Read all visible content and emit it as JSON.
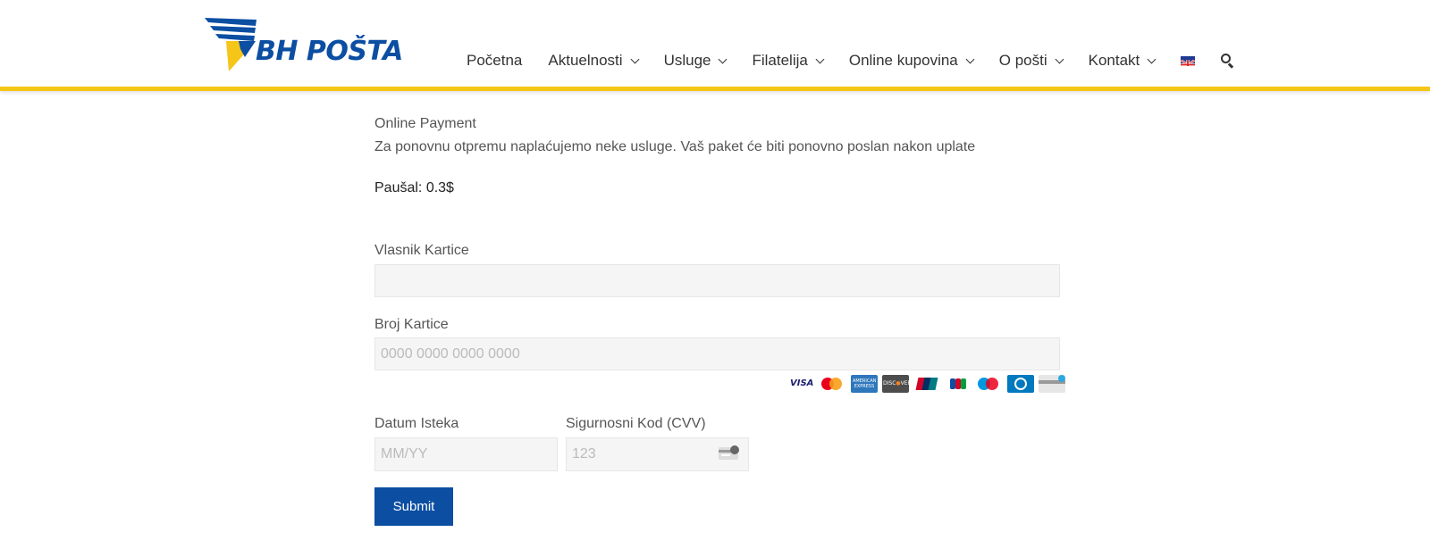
{
  "brand": {
    "logo_text": "BH POŠTA",
    "primary_color": "#0b4ea2",
    "accent_color": "#f5c518"
  },
  "nav": {
    "items": [
      {
        "label": "Početna",
        "has_dropdown": false
      },
      {
        "label": "Aktuelnosti",
        "has_dropdown": true
      },
      {
        "label": "Usluge",
        "has_dropdown": true
      },
      {
        "label": "Filatelija",
        "has_dropdown": true
      },
      {
        "label": "Online kupovina",
        "has_dropdown": true
      },
      {
        "label": "O pošti",
        "has_dropdown": true
      },
      {
        "label": "Kontakt",
        "has_dropdown": true
      }
    ],
    "language_icon": "uk-flag-icon",
    "search_icon": "search-icon"
  },
  "page": {
    "title": "Online Payment",
    "description": "Za ponovnu otpremu naplaćujemo neke usluge. Vaš paket će biti ponovno poslan nakon uplate",
    "fee": "Paušal: 0.3$"
  },
  "form": {
    "cardholder": {
      "label": "Vlasnik Kartice",
      "value": "",
      "placeholder": ""
    },
    "card_number": {
      "label": "Broj Kartice",
      "value": "",
      "placeholder": "0000 0000 0000 0000"
    },
    "card_brands": [
      {
        "name": "visa-icon",
        "text": "VISA"
      },
      {
        "name": "mastercard-icon",
        "text": "MasterCard"
      },
      {
        "name": "amex-icon",
        "text": "AMERICAN EXPRESS"
      },
      {
        "name": "discover-icon",
        "text": "DISCOVER"
      },
      {
        "name": "unionpay-icon",
        "text": "UnionPay"
      },
      {
        "name": "jcb-icon",
        "text": "JCB"
      },
      {
        "name": "maestro-icon",
        "text": "Maestro"
      },
      {
        "name": "diners-icon",
        "text": ""
      },
      {
        "name": "generic-card-icon",
        "text": ""
      }
    ],
    "expiry": {
      "label": "Datum Isteka",
      "value": "",
      "placeholder": "MM/YY"
    },
    "cvv": {
      "label": "Sigurnosni Kod (CVV)",
      "value": "",
      "placeholder": "123"
    },
    "submit_label": "Submit"
  }
}
